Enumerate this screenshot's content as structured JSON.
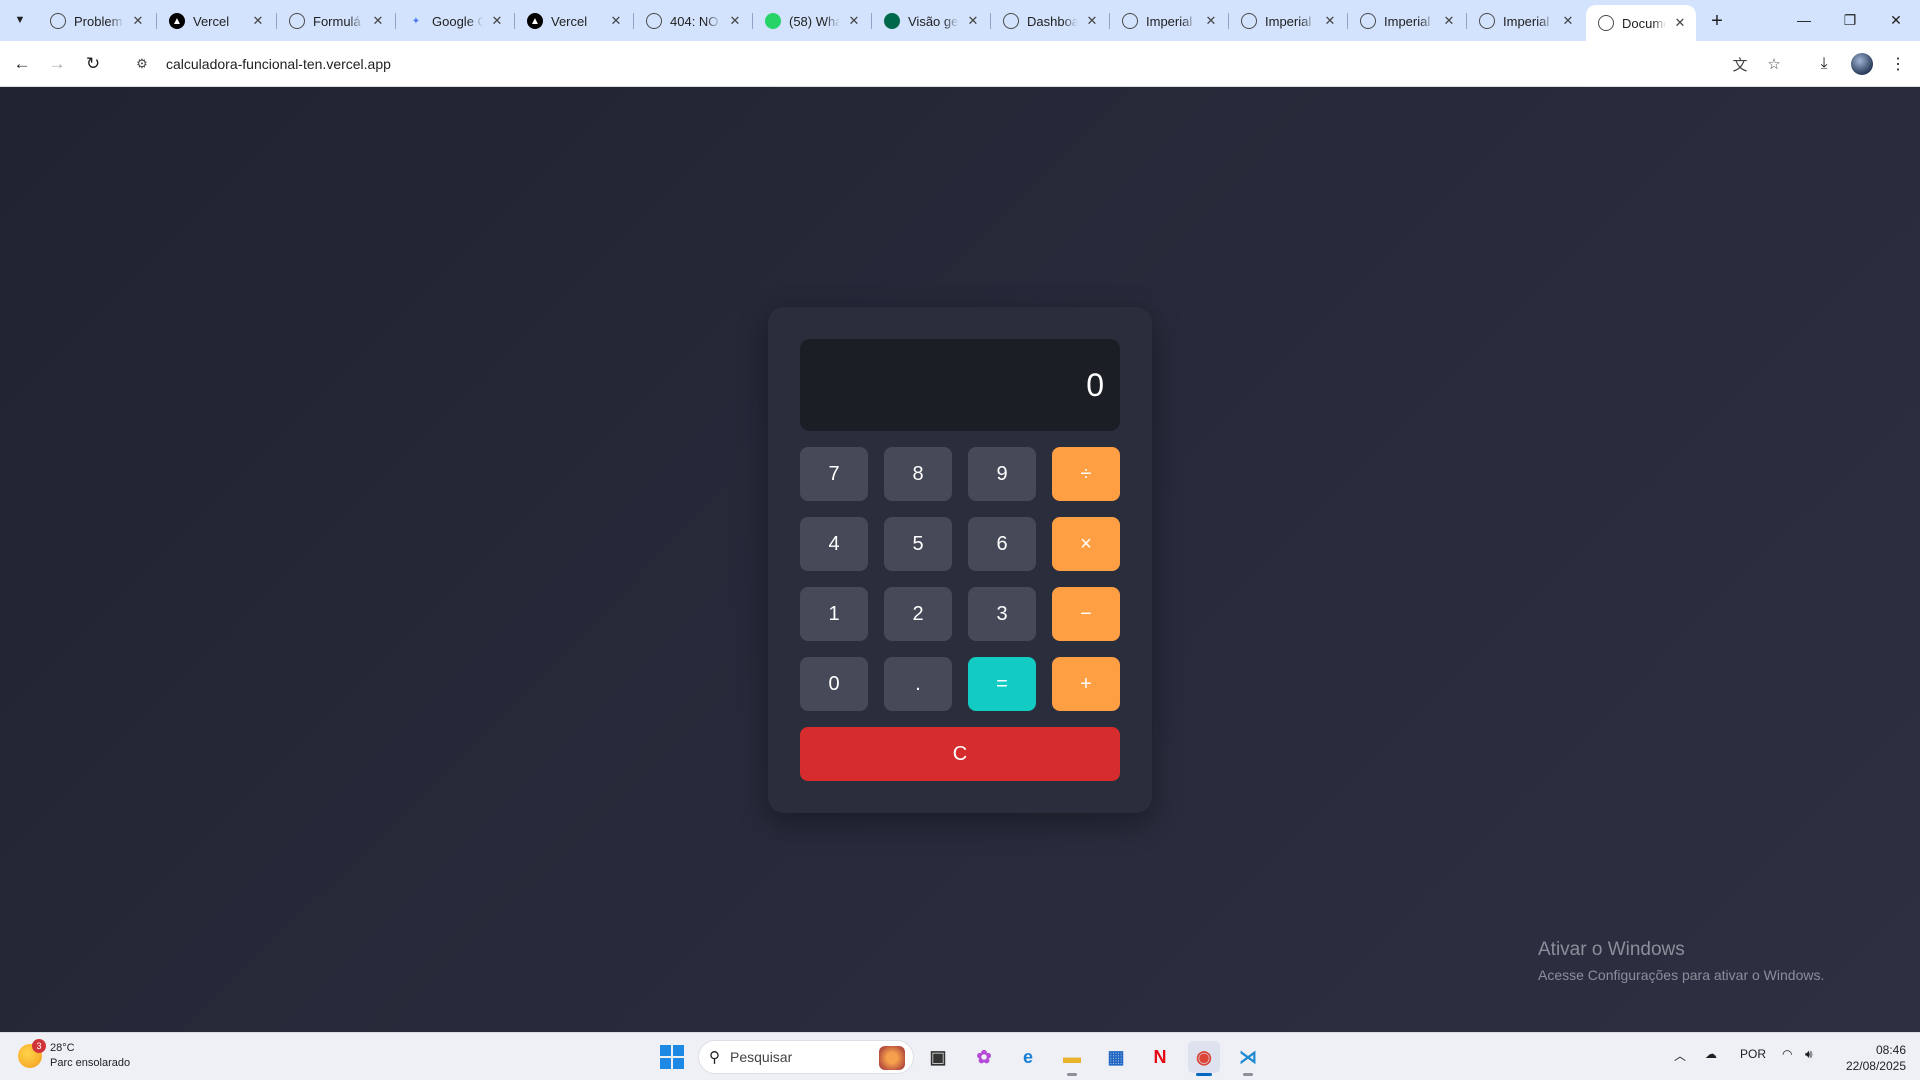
{
  "browser": {
    "tabs": [
      {
        "title": "Problem",
        "favicon": "globe-icon"
      },
      {
        "title": "Vercel",
        "favicon": "vercel-icon"
      },
      {
        "title": "Formulá",
        "favicon": "globe-icon"
      },
      {
        "title": "Google G",
        "favicon": "gemini-icon"
      },
      {
        "title": "Vercel",
        "favicon": "vercel-icon"
      },
      {
        "title": "404: NO",
        "favicon": "globe-icon"
      },
      {
        "title": "(58) Wha",
        "favicon": "whatsapp-icon"
      },
      {
        "title": "Visão ge",
        "favicon": "mongodb-icon"
      },
      {
        "title": "Dashboa",
        "favicon": "globe-icon"
      },
      {
        "title": "Imperial",
        "favicon": "globe-icon"
      },
      {
        "title": "Imperial",
        "favicon": "globe-icon"
      },
      {
        "title": "Imperial",
        "favicon": "globe-icon"
      },
      {
        "title": "Imperial",
        "favicon": "globe-icon"
      },
      {
        "title": "Docume",
        "favicon": "globe-icon"
      }
    ],
    "url": "calculadora-funcional-ten.vercel.app"
  },
  "calculator": {
    "display": "0",
    "keys": {
      "k7": "7",
      "k8": "8",
      "k9": "9",
      "div": "÷",
      "k4": "4",
      "k5": "5",
      "k6": "6",
      "mul": "×",
      "k1": "1",
      "k2": "2",
      "k3": "3",
      "sub": "−",
      "k0": "0",
      "dot": ".",
      "eq": "=",
      "add": "+",
      "clear": "C"
    },
    "colors": {
      "operator": "#ff9f43",
      "equals": "#12ccc4",
      "clear": "#d72c2e",
      "digit": "#454958"
    }
  },
  "watermark": {
    "line1": "Ativar o Windows",
    "line2": "Acesse Configurações para ativar o Windows."
  },
  "taskbar": {
    "weather_temp": "28°C",
    "weather_desc": "Parc ensolarado",
    "weather_badge": "3",
    "search_placeholder": "Pesquisar",
    "language": "POR",
    "time": "08:46",
    "date": "22/08/2025"
  }
}
